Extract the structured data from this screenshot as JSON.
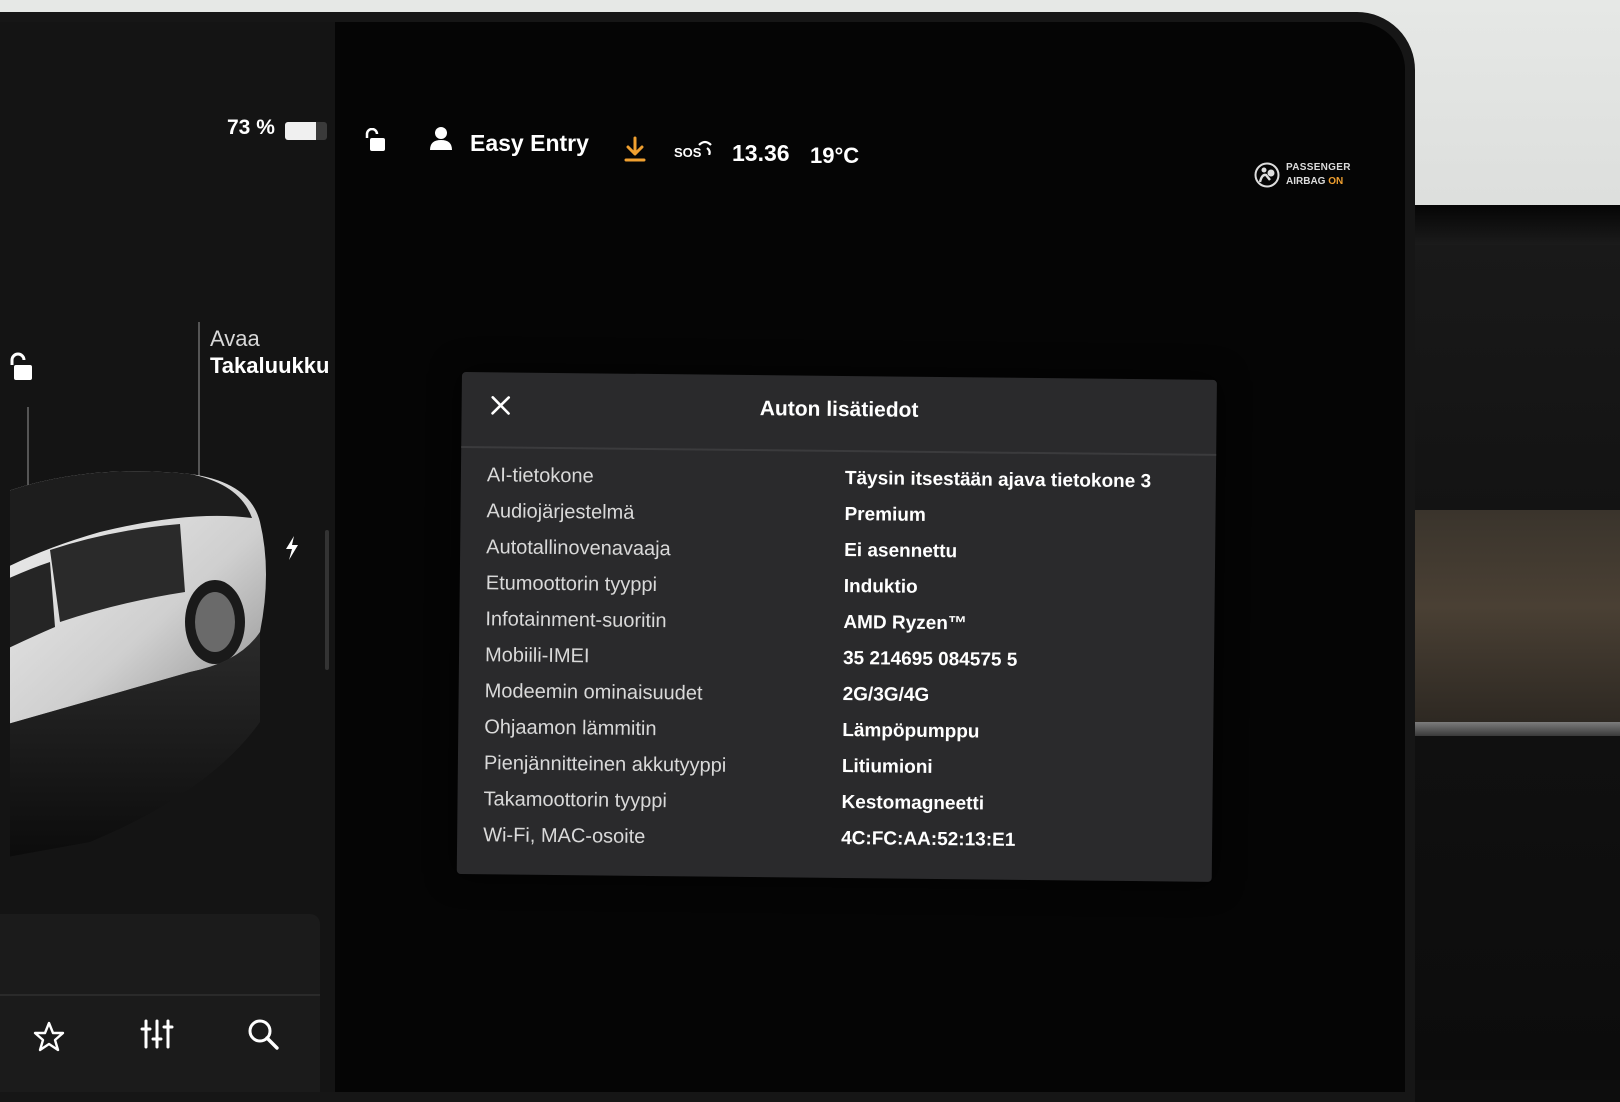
{
  "status_bar": {
    "battery_percent_text": "73 %",
    "battery_level": 0.73,
    "profile_label": "Easy Entry",
    "sos_label": "SOS",
    "time": "13.36",
    "temperature": "19°C",
    "airbag_line1": "PASSENGER",
    "airbag_line2_prefix": "AIRBAG",
    "airbag_line2_status": "ON"
  },
  "left_panel": {
    "trunk_action_small": "Avaa",
    "trunk_action_big": "Takaluukku"
  },
  "dock": {
    "icons": [
      "star-icon",
      "sliders-icon",
      "search-icon"
    ]
  },
  "modal": {
    "title": "Auton lisätiedot",
    "rows": [
      {
        "label": "AI-tietokone",
        "value": "Täysin itsestään ajava tietokone 3"
      },
      {
        "label": "Audiojärjestelmä",
        "value": "Premium"
      },
      {
        "label": "Autotallinovenavaaja",
        "value": "Ei asennettu"
      },
      {
        "label": "Etumoottorin tyyppi",
        "value": "Induktio"
      },
      {
        "label": "Infotainment-suoritin",
        "value": "AMD Ryzen™"
      },
      {
        "label": "Mobiili-IMEI",
        "value": "35 214695 084575 5"
      },
      {
        "label": "Modeemin ominaisuudet",
        "value": "2G/3G/4G"
      },
      {
        "label": "Ohjaamon lämmitin",
        "value": "Lämpöpumppu"
      },
      {
        "label": "Pienjännitteinen akkutyyppi",
        "value": "Litiumioni"
      },
      {
        "label": "Takamoottorin tyyppi",
        "value": "Kestomagneetti"
      },
      {
        "label": "Wi-Fi, MAC-osoite",
        "value": "4C:FC:AA:52:13:E1"
      }
    ]
  },
  "colors": {
    "accent_orange": "#f0a030",
    "modal_bg": "#2a2a2c",
    "panel_bg": "#141414"
  }
}
